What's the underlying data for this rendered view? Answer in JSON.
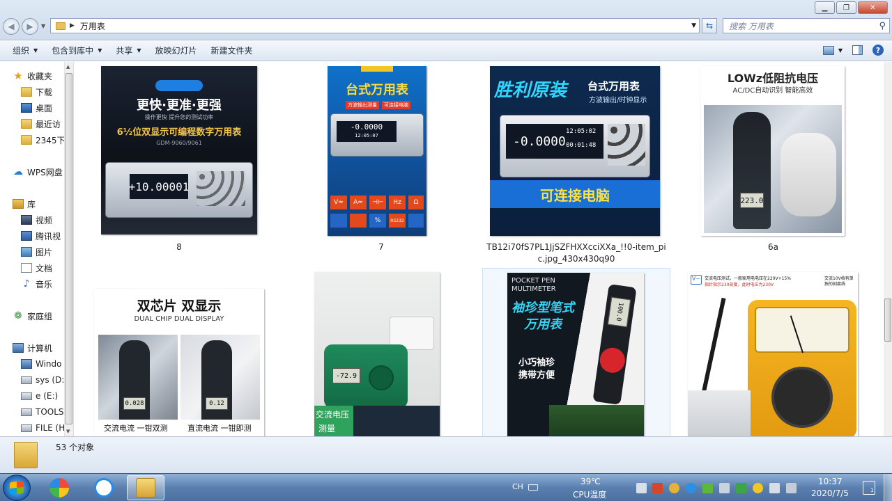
{
  "window": {
    "address_path": "万用表",
    "search_placeholder": "搜索 万用表"
  },
  "toolbar": {
    "organize": "组织",
    "include_in_library": "包含到库中",
    "share": "共享",
    "slideshow": "放映幻灯片",
    "new_folder": "新建文件夹"
  },
  "nav": {
    "favorites": "收藏夹",
    "downloads": "下载",
    "desktop": "桌面",
    "recent": "最近访",
    "folder_2345": "2345下",
    "wps": "WPS网盘",
    "libraries": "库",
    "videos": "视频",
    "tencent": "腾讯视",
    "pictures": "图片",
    "documents": "文档",
    "music": "音乐",
    "homegroup": "家庭组",
    "computer": "计算机",
    "drive_windows": "Windo",
    "drive_sys": "sys (D:",
    "drive_e": "e (E:)",
    "drive_tools": "TOOLS",
    "drive_file": "FILE (H"
  },
  "files": [
    {
      "caption": "8",
      "lines": [
        "更快·更准·更强",
        "操作更快 提升您的测试功率",
        "6½位双显示可编程数字万用表",
        "GDM-9060/9061",
        "+10.00001"
      ]
    },
    {
      "caption": "7",
      "lines": [
        "台式万用表",
        "方波输出测量",
        "可连接电脑",
        "-0.0000",
        "12:05:07",
        "V≈",
        "A≈",
        "⊣⊢",
        "Hz",
        "Ω",
        "%",
        "RS232"
      ]
    },
    {
      "caption": "TB12i70fS7PL1JjSZFHXXcciXXa_!!0-item_pic.jpg_430x430q90",
      "lines": [
        "胜利原装",
        "台式万用表",
        "方波输出/时钟显示",
        "-0.0000",
        "12:05:02",
        "00:01:48",
        "可连接电脑"
      ]
    },
    {
      "caption": "6a",
      "lines": [
        "LOWz低阻抗电压",
        "AC/DC自动识别 智能高效",
        "223.0"
      ]
    },
    {
      "caption": "",
      "lines": [
        "双芯片 双显示",
        "DUAL CHIP DUAL DISPLAY",
        "交流电流 一钳双测",
        "直流电流 一钳即测",
        "0.028",
        "0.12"
      ]
    },
    {
      "caption": "",
      "lines": [
        "交流电压",
        "测量",
        "-72.9"
      ]
    },
    {
      "caption": "",
      "lines": [
        "POCKET PEN",
        "MULTIMETER",
        "袖珍型笔式",
        "万用表",
        "小巧袖珍",
        "携带方便",
        "100.0"
      ]
    },
    {
      "caption": "",
      "lines": [
        "交流电压测试，一般家用电电压在220V+15%",
        "指针指示230刻度，此时电压为230V",
        "交流10V档有单独的刻度线"
      ]
    }
  ],
  "status": {
    "object_count": "53 个对象"
  },
  "taskbar": {
    "ime": "CH",
    "temp_value": "39℃",
    "temp_label": "CPU温度",
    "time": "10:37",
    "date": "2020/7/5",
    "notif_count": "1"
  }
}
